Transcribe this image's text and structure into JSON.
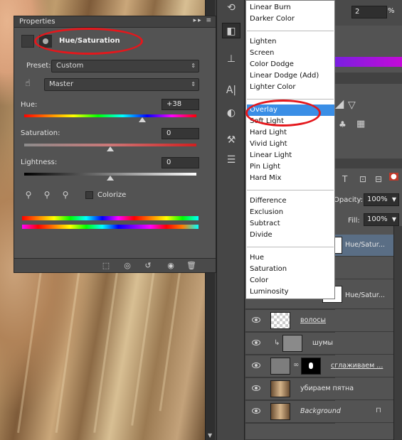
{
  "properties": {
    "title": "Properties",
    "adjustment_title": "Hue/Saturation",
    "preset_label": "Preset:",
    "preset_value": "Custom",
    "channel_value": "Master",
    "hue_label": "Hue:",
    "hue_value": "+38",
    "saturation_label": "Saturation:",
    "saturation_value": "0",
    "lightness_label": "Lightness:",
    "lightness_value": "0",
    "colorize_label": "Colorize"
  },
  "top_right": {
    "opacity_value": "2",
    "percent": "%"
  },
  "blend_menu": {
    "items": [
      "Linear Burn",
      "Darker Color",
      "Lighten",
      "Screen",
      "Color Dodge",
      "Linear Dodge (Add)",
      "Lighter Color",
      "Overlay",
      "Soft Light",
      "Hard Light",
      "Vivid Light",
      "Linear Light",
      "Pin Light",
      "Hard Mix",
      "Difference",
      "Exclusion",
      "Subtract",
      "Divide",
      "Hue",
      "Saturation",
      "Color",
      "Luminosity"
    ],
    "selected": "Overlay"
  },
  "layers_panel": {
    "opacity_label": "Opacity:",
    "opacity_value": "100%",
    "fill_label": "Fill:",
    "fill_value": "100%",
    "layers": [
      {
        "name": "Hue/Satur..."
      },
      {
        "name": "Hue/Satur..."
      },
      {
        "name": "волосы"
      },
      {
        "name": "шумы"
      },
      {
        "name": "сглаживаем ..."
      },
      {
        "name": "убираем пятна"
      },
      {
        "name": "Background"
      }
    ]
  },
  "colors": {
    "highlight": "#3a8ee6",
    "annotation": "#e4171c"
  }
}
